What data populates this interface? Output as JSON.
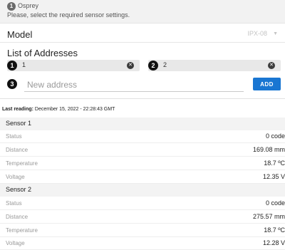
{
  "notice": {
    "badge": "1",
    "title": "Osprey",
    "message": "Please, select the required sensor settings."
  },
  "model": {
    "label": "Model",
    "value": "IPX-08"
  },
  "addresses": {
    "title": "List of Addresses",
    "items": [
      {
        "badge": "1",
        "value": "1"
      },
      {
        "badge": "2",
        "value": "2"
      }
    ],
    "new": {
      "badge": "3",
      "placeholder": "New address",
      "add_label": "ADD"
    }
  },
  "last_reading": {
    "label": "Last reading:",
    "value": "December 15, 2022 - 22:28:43 GMT"
  },
  "sensors": [
    {
      "name": "Sensor 1",
      "rows": [
        {
          "key": "Status",
          "value": "0 code"
        },
        {
          "key": "Distance",
          "value": "169.08 mm"
        },
        {
          "key": "Temperature",
          "value": "18.7 ºC"
        },
        {
          "key": "Voltage",
          "value": "12.35 V"
        }
      ]
    },
    {
      "name": "Sensor 2",
      "rows": [
        {
          "key": "Status",
          "value": "0 code"
        },
        {
          "key": "Distance",
          "value": "275.57 mm"
        },
        {
          "key": "Temperature",
          "value": "18.7 ºC"
        },
        {
          "key": "Voltage",
          "value": "12.28 V"
        }
      ]
    }
  ],
  "colors": {
    "accent": "#1976d2",
    "badge": "#111111",
    "chip_bg": "#e8e8e8"
  }
}
